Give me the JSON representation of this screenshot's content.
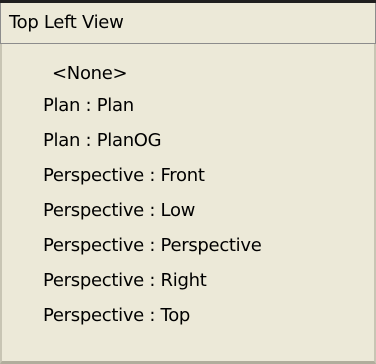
{
  "dropdown": {
    "selected_value": "Top Left View",
    "options": [
      "<None>",
      "Plan : Plan",
      "Plan : PlanOG",
      "Perspective : Front",
      "Perspective : Low",
      "Perspective : Perspective",
      "Perspective : Right",
      "Perspective : Top"
    ]
  }
}
